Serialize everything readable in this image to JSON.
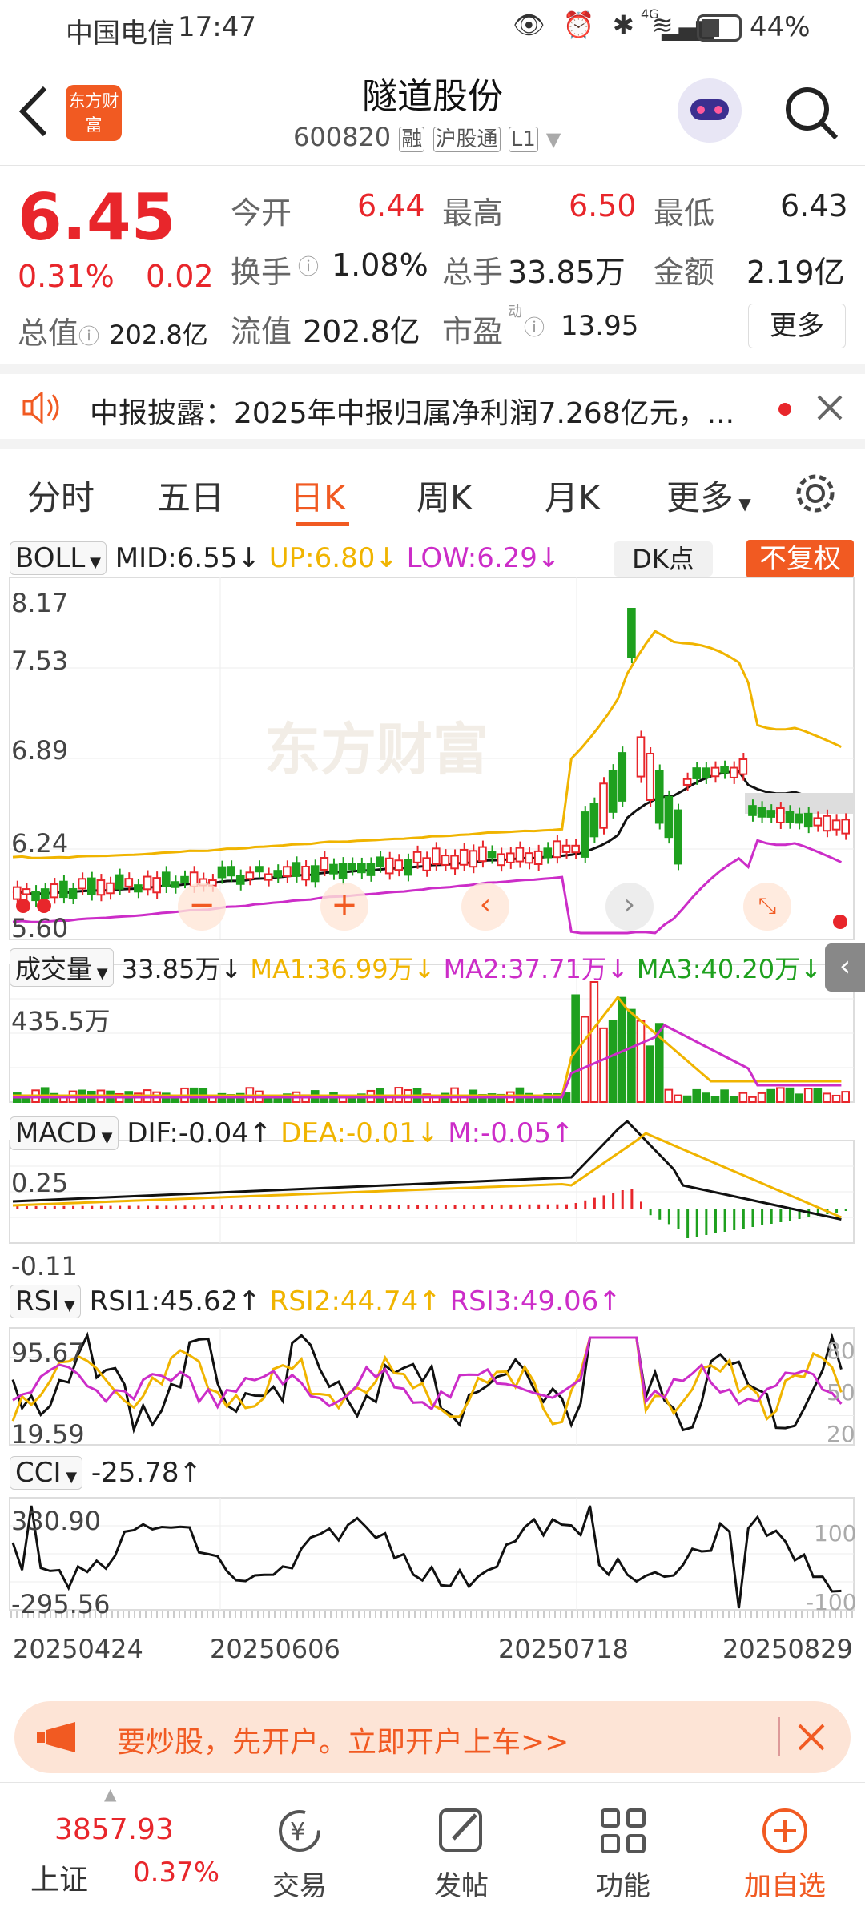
{
  "status": {
    "carrier": "中国电信",
    "time": "17:47",
    "network": "4G",
    "battery": "44%"
  },
  "header": {
    "title": "隧道股份",
    "code": "600820",
    "tags": [
      "融",
      "沪股通",
      "L1"
    ],
    "logo_text": "东方财富"
  },
  "quote": {
    "price": "6.45",
    "pct": "0.31%",
    "chg": "0.02",
    "open_label": "今开",
    "open": "6.44",
    "high_label": "最高",
    "high": "6.50",
    "low_label": "最低",
    "low": "6.43",
    "turnover_label": "换手",
    "turnover": "1.08%",
    "volume_label": "总手",
    "volume": "33.85万",
    "amount_label": "金额",
    "amount": "2.19亿",
    "mcap_label": "总值",
    "mcap": "202.8亿",
    "float_label": "流值",
    "float": "202.8亿",
    "pe_label": "市盈",
    "pe_sup": "动",
    "pe": "13.95",
    "more": "更多"
  },
  "notice": {
    "text": "中报披露：2025年中报归属净利润7.268亿元，..."
  },
  "tabs": [
    "分时",
    "五日",
    "日K",
    "周K",
    "月K",
    "更多"
  ],
  "active_tab": "日K",
  "boll": {
    "name": "BOLL",
    "mid": "MID:6.55↓",
    "up": "UP:6.80↓",
    "low": "LOW:6.29↓",
    "dk": "DK点",
    "fq": "不复权",
    "y_ticks": [
      "8.17",
      "7.53",
      "6.89",
      "6.24",
      "5.60"
    ],
    "watermark": "东方财富"
  },
  "vol": {
    "name": "成交量",
    "v": "33.85万↓",
    "ma1": "MA1:36.99万↓",
    "ma2": "MA2:37.71万↓",
    "ma3": "MA3:40.20万↓",
    "y_top": "435.5万"
  },
  "macd": {
    "name": "MACD",
    "dif": "DIF:-0.04↑",
    "dea": "DEA:-0.01↓",
    "m": "M:-0.05↑",
    "y_top": "0.25",
    "y_bot": "-0.11"
  },
  "rsi": {
    "name": "RSI",
    "r1": "RSI1:45.62↑",
    "r2": "RSI2:44.74↑",
    "r3": "RSI3:49.06↑",
    "y_top": "95.67",
    "y_bot": "19.59",
    "right": [
      "80",
      "50",
      "20"
    ]
  },
  "cci": {
    "name": "CCI",
    "v": "-25.78↑",
    "y_top": "330.90",
    "y_bot": "-295.56",
    "right": [
      "100",
      "-100"
    ]
  },
  "dates": [
    "20250424",
    "20250606",
    "20250718",
    "20250829"
  ],
  "ad": {
    "text": "要炒股，先开户。立即开户上车>>"
  },
  "bottom": {
    "index_value": "3857.93",
    "index_name": "上证",
    "index_pct": "0.37%",
    "items": [
      "交易",
      "发帖",
      "功能",
      "加自选"
    ]
  },
  "colors": {
    "up": "#e8262b",
    "down": "#1ea01e",
    "accent": "#f15a22",
    "yellow": "#f0b400",
    "pink": "#cc2dc8"
  }
}
